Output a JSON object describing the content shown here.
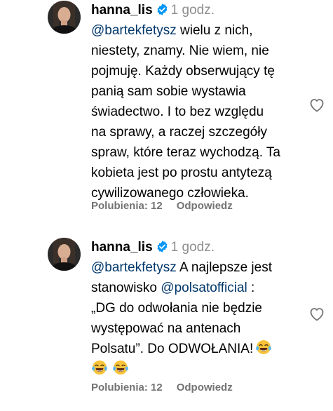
{
  "comments": [
    {
      "username": "hanna_lis",
      "time": "1 godz.",
      "mention": "@bartekfetysz",
      "line1_rest": " wielu z nich,",
      "lines": [
        "niestety, znamy. Nie wiem, nie",
        "pojmuję. Każdy obserwujący tę",
        "panią sam sobie wystawia",
        "świadectwo. I to bez względu",
        "na sprawy, a raczej szczegóły",
        "spraw, które teraz wychodzą. Ta",
        "kobieta jest po prostu antytezą",
        "cywilizowanego człowieka."
      ],
      "likes": "Polubienia: 12",
      "reply": "Odpowiedz"
    },
    {
      "username": "hanna_lis",
      "time": "1 godz.",
      "mention": "@bartekfetysz",
      "line1_rest": " A najlepsze jest",
      "line2_prefix": "stanowisko ",
      "mention2": "@polsatofficial",
      "line2_suffix": " :",
      "lines": [
        "„DG do odwołania nie będzie",
        "występować na antenach"
      ],
      "last_line": "Polsatu”. Do ODWOŁANIA!",
      "likes": "Polubienia: 12",
      "reply": "Odpowiedz"
    }
  ],
  "icons": {
    "verified": "verified-badge-icon",
    "like": "heart-outline-icon",
    "emoji": "face-with-tears-of-joy-emoji"
  },
  "colors": {
    "mention": "#00376b",
    "secondary": "#737373",
    "verified": "#0095f6"
  }
}
